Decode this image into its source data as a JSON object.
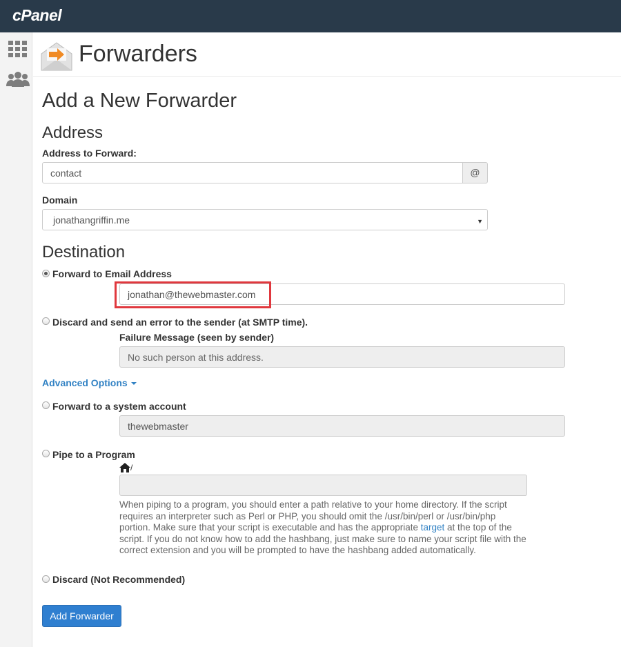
{
  "app": {
    "brand": "cPanel"
  },
  "page": {
    "title": "Forwarders",
    "heading": "Add a New Forwarder"
  },
  "address": {
    "section_title": "Address",
    "field_label": "Address to Forward:",
    "field_value": "contact",
    "at_addon": "@",
    "domain_label": "Domain",
    "domain_value": "jonathangriffin.me"
  },
  "destination": {
    "section_title": "Destination",
    "forward_email": {
      "label": "Forward to Email Address",
      "value": "jonathan@thewebmaster.com",
      "selected": true
    },
    "discard_error": {
      "label": "Discard and send an error to the sender (at SMTP time).",
      "failure_label": "Failure Message (seen by sender)",
      "failure_placeholder": "No such person at this address."
    },
    "advanced_options": "Advanced Options",
    "system_account": {
      "label": "Forward to a system account",
      "value": "thewebmaster"
    },
    "pipe": {
      "label": "Pipe to a Program",
      "path_suffix": "/",
      "help_before": "When piping to a program, you should enter a path relative to your home directory. If the script requires an interpreter such as Perl or PHP, you should omit the /usr/bin/perl or /usr/bin/php portion. Make sure that your script is executable and has the appropriate ",
      "help_link": "target",
      "help_after": " at the top of the script. If you do not know how to add the hashbang, just make sure to name your script file with the correct extension and you will be prompted to have the hashbang added automatically."
    },
    "discard": {
      "label": "Discard (Not Recommended)"
    }
  },
  "actions": {
    "submit": "Add Forwarder"
  },
  "colors": {
    "topbar": "#293a4a",
    "accent": "#2f7fd0",
    "highlight": "#e0383e",
    "link": "#3282c4"
  }
}
